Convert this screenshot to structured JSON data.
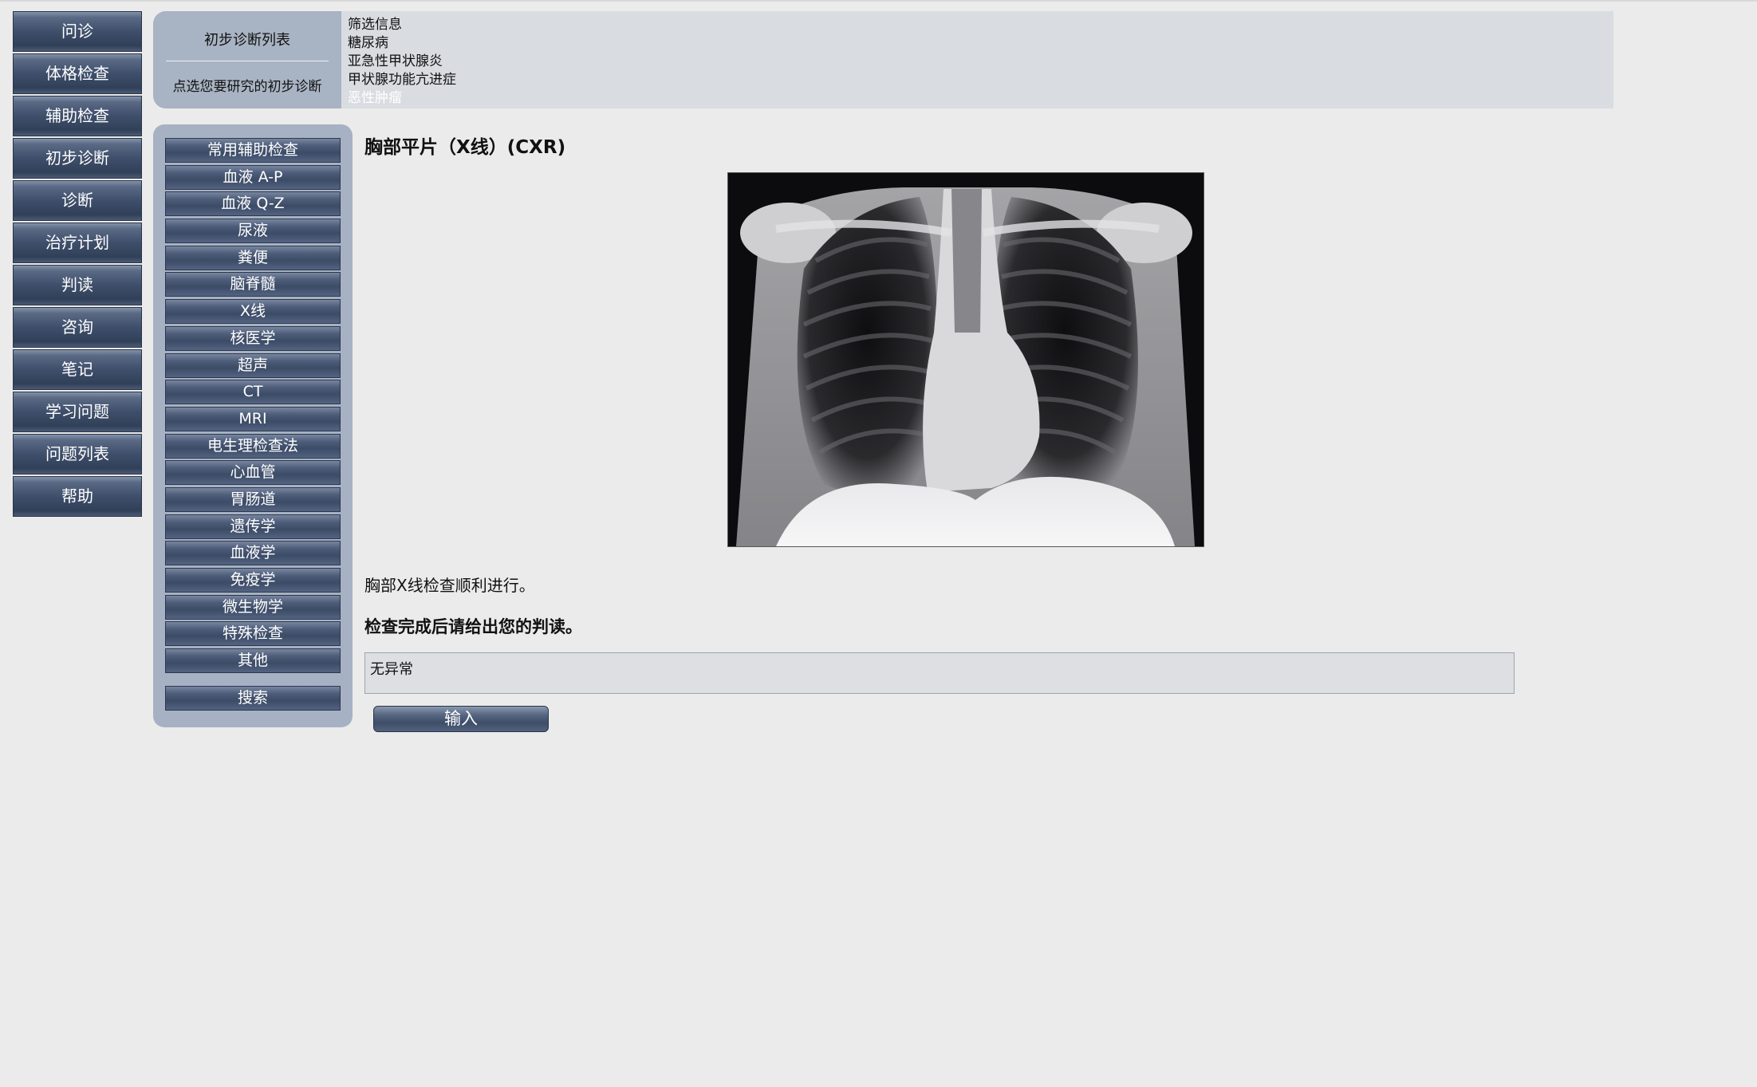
{
  "left_nav": {
    "items": [
      "问诊",
      "体格检查",
      "辅助检查",
      "初步诊断",
      "诊断",
      "治疗计划",
      "判读",
      "咨询",
      "笔记",
      "学习问题",
      "问题列表",
      "帮助"
    ]
  },
  "diagnosis_panel": {
    "title": "初步诊断列表",
    "hint": "点选您要研究的初步诊断",
    "items": [
      "筛选信息",
      "糖尿病",
      "亚急性甲状腺炎",
      "甲状腺功能亢进症",
      "恶性肿瘤"
    ]
  },
  "categories": {
    "items": [
      "常用辅助检查",
      "血液 A-P",
      "血液 Q-Z",
      "尿液",
      "粪便",
      "脑脊髓",
      "X线",
      "核医学",
      "超声",
      "CT",
      "MRI",
      "电生理检查法",
      "心血管",
      "胃肠道",
      "遗传学",
      "血液学",
      "免疫学",
      "微生物学",
      "特殊检查",
      "其他"
    ],
    "search_label": "搜索"
  },
  "main": {
    "title": "胸部平片（X线）(CXR)",
    "result_text": "胸部X线检查顺利进行。",
    "prompt_text": "检查完成后请给出您的判读。",
    "answer_value": "无异常",
    "submit_label": "输入"
  }
}
